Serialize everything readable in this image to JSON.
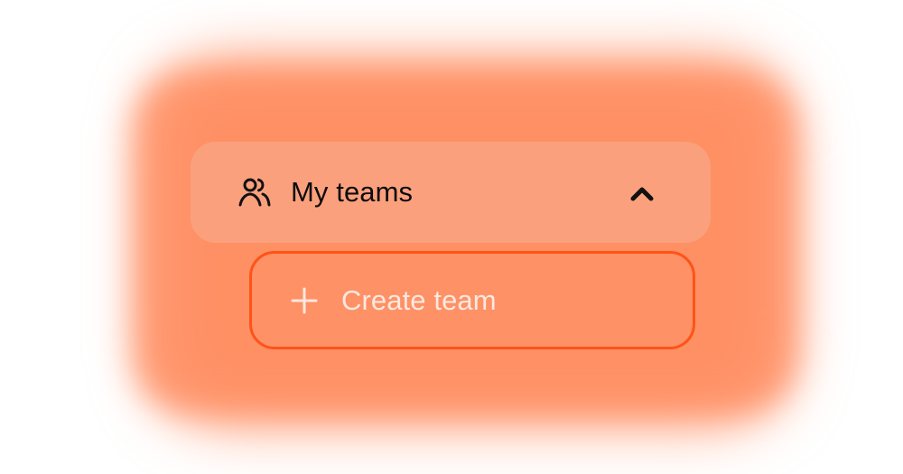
{
  "menu": {
    "teams_label": "My teams",
    "teams_icon": "users-icon",
    "expanded_state_icon": "chevron-up-icon",
    "create_label": "Create team",
    "create_icon": "plus-icon"
  },
  "colors": {
    "accent": "#ff5317",
    "glow": "#ff8c5e",
    "header_bg": "#fba07d",
    "create_bg": "#fe9166",
    "header_text": "#0c0c0c",
    "create_text": "#fbe8df"
  }
}
